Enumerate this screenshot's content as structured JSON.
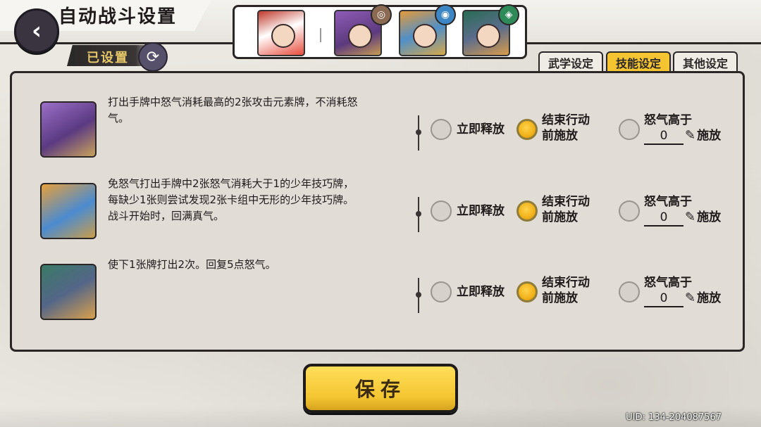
{
  "header": {
    "title": "自动战斗设置",
    "back_icon": "back-arrow-icon",
    "status_label": "已设置"
  },
  "characters": [
    {
      "name": "main-character-portrait",
      "element": ""
    },
    {
      "name": "char-1-portrait",
      "element": "earth-icon"
    },
    {
      "name": "char-2-portrait",
      "element": "water-icon"
    },
    {
      "name": "char-3-portrait",
      "element": "wind-icon"
    }
  ],
  "tabs": [
    {
      "label": "武学设定",
      "active": false
    },
    {
      "label": "技能设定",
      "active": true
    },
    {
      "label": "其他设定",
      "active": false
    }
  ],
  "skills": [
    {
      "description": "打出手牌中怒气消耗最高的2张攻击元素牌，不消耗怒\n气。",
      "options": {
        "immediate": "立即释放",
        "end_turn": "结束行动\n前施放",
        "threshold_prefix": "怒气高于",
        "threshold_value": "0",
        "threshold_suffix": "施放"
      },
      "selected": "end_turn"
    },
    {
      "description": "免怒气打出手牌中2张怒气消耗大于1的少年技巧牌，\n每缺少1张则尝试发现2张卡组中无形的少年技巧牌。\n战斗开始时，回满真气。",
      "options": {
        "immediate": "立即释放",
        "end_turn": "结束行动\n前施放",
        "threshold_prefix": "怒气高于",
        "threshold_value": "0",
        "threshold_suffix": "施放"
      },
      "selected": "end_turn"
    },
    {
      "description": "使下1张牌打出2次。回复5点怒气。",
      "options": {
        "immediate": "立即释放",
        "end_turn": "结束行动\n前施放",
        "threshold_prefix": "怒气高于",
        "threshold_value": "0",
        "threshold_suffix": "施放"
      },
      "selected": "end_turn"
    }
  ],
  "footer": {
    "save_label": "保存",
    "uid": "UID: 134-204087567"
  },
  "colors": {
    "accent": "#f4c531",
    "dark": "#2a2626",
    "panel": "#e2dcd6"
  }
}
